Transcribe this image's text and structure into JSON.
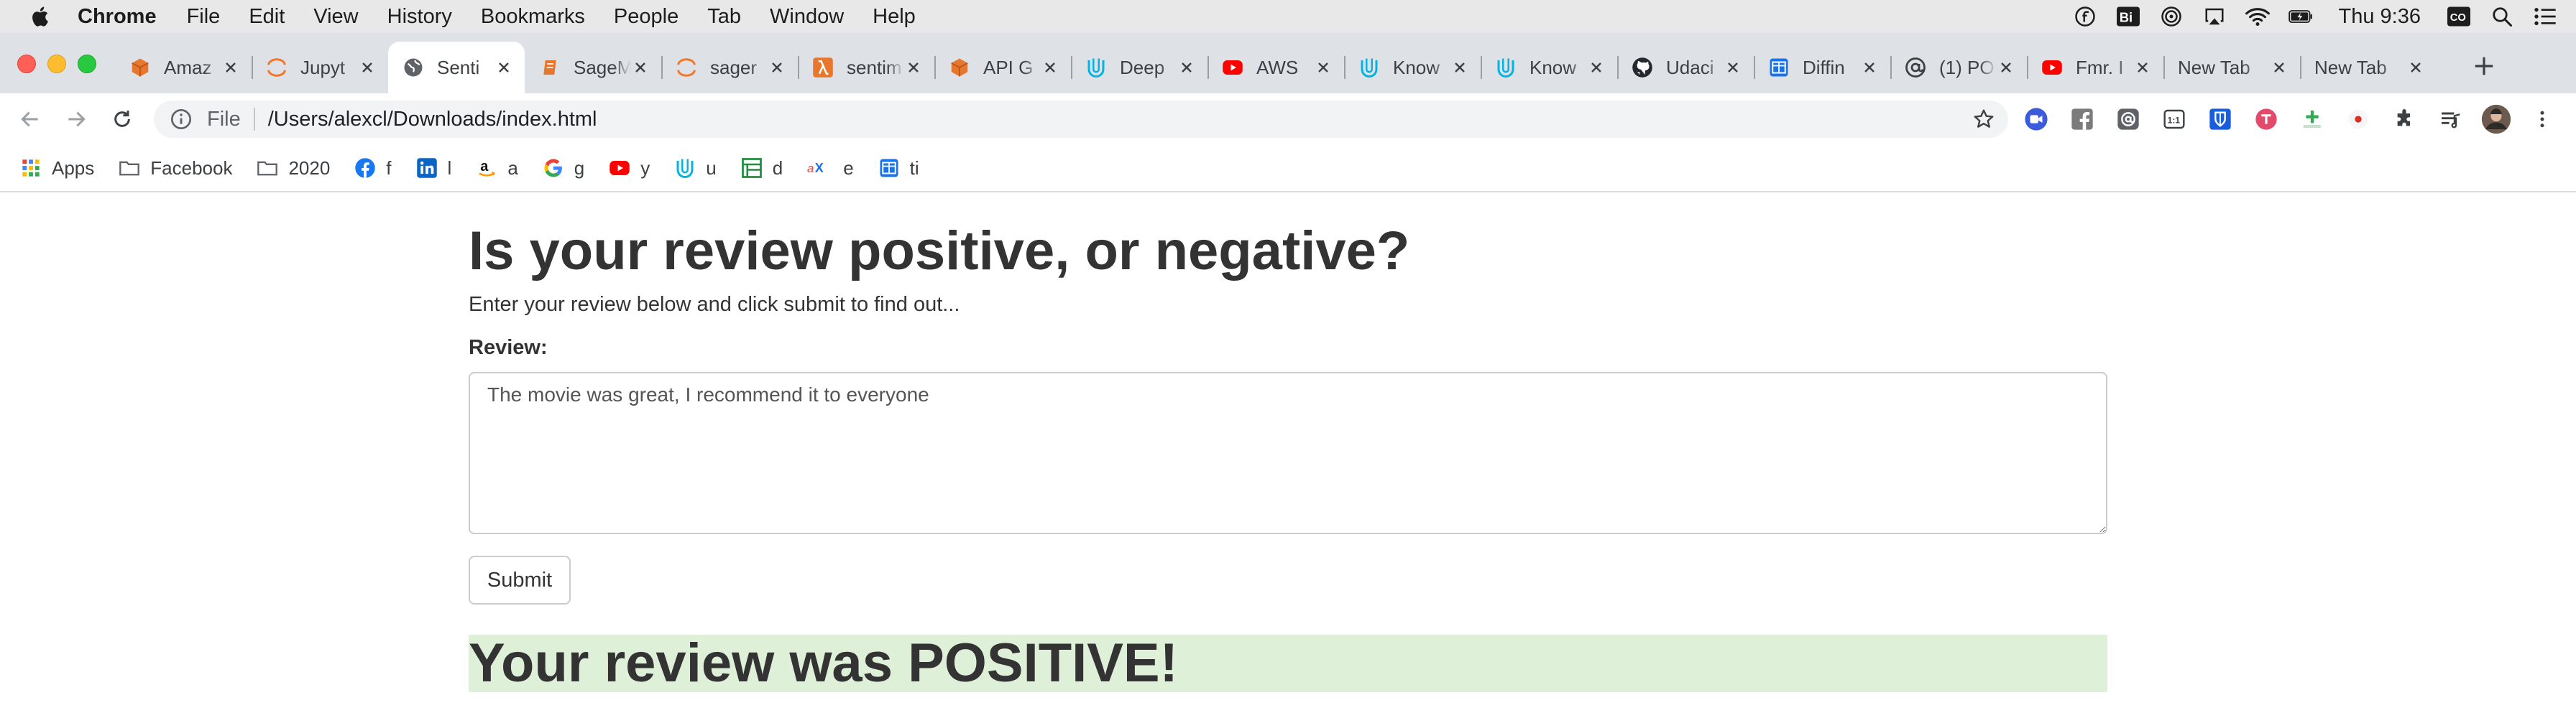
{
  "menubar": {
    "app": "Chrome",
    "items": [
      "File",
      "Edit",
      "View",
      "History",
      "Bookmarks",
      "People",
      "Tab",
      "Window",
      "Help"
    ],
    "clock": "Thu 9:36",
    "status_icons": [
      "circle-f-icon",
      "bi-icon",
      "record-icon",
      "airplay-icon",
      "wifi-icon",
      "battery-icon",
      "co-icon",
      "spotlight-search-icon",
      "control-center-icon"
    ]
  },
  "tabs": [
    {
      "title": "Amaz",
      "icon": "aws-box-icon",
      "color": "#e8772e"
    },
    {
      "title": "Jupyt",
      "icon": "jupyter-icon",
      "color": "#f37726"
    },
    {
      "title": "Senti",
      "icon": "globe-icon",
      "color": "#5f6368",
      "active": true
    },
    {
      "title": "SageM",
      "icon": "sagemaker-icon",
      "color": "#e8772e"
    },
    {
      "title": "sager",
      "icon": "jupyter-icon",
      "color": "#f37726"
    },
    {
      "title": "sentim",
      "icon": "lambda-icon",
      "color": "#e8772e"
    },
    {
      "title": "API G",
      "icon": "aws-box-icon",
      "color": "#e8772e"
    },
    {
      "title": "Deep",
      "icon": "udacity-icon",
      "color": "#02b3e4"
    },
    {
      "title": "AWS",
      "icon": "youtube-icon",
      "color": "#ff0000"
    },
    {
      "title": "Know",
      "icon": "udacity-icon",
      "color": "#02b3e4"
    },
    {
      "title": "Know",
      "icon": "udacity-icon",
      "color": "#02b3e4"
    },
    {
      "title": "Udaci",
      "icon": "github-icon",
      "color": "#24292e"
    },
    {
      "title": "Diffin",
      "icon": "table-icon",
      "color": "#1a73e8"
    },
    {
      "title": "(1) PO",
      "icon": "at-icon",
      "color": "#3c4043"
    },
    {
      "title": "Fmr. I",
      "icon": "youtube-icon",
      "color": "#ff0000"
    },
    {
      "title": "New Tab",
      "icon": "",
      "color": ""
    },
    {
      "title": "New Tab",
      "icon": "",
      "color": ""
    }
  ],
  "toolbar": {
    "scheme": "File",
    "url": "/Users/alexcl/Downloads/index.html",
    "extensions": [
      "meet-icon",
      "facebook-square-icon",
      "at-icon",
      "ratio-icon",
      "bitwarden-icon",
      "todoist-icon",
      "plus-green-icon",
      "record-dot-icon",
      "puzzle-icon",
      "media-queue-icon",
      "profile-avatar-icon",
      "menu-kebab-icon"
    ]
  },
  "bookmarks": [
    {
      "label": "Apps",
      "icon": "apps-grid-icon"
    },
    {
      "label": "Facebook",
      "icon": "folder-icon"
    },
    {
      "label": "2020",
      "icon": "folder-icon"
    },
    {
      "label": "f",
      "icon": "facebook-icon"
    },
    {
      "label": "l",
      "icon": "linkedin-icon"
    },
    {
      "label": "a",
      "icon": "amazon-icon"
    },
    {
      "label": "g",
      "icon": "google-icon"
    },
    {
      "label": "y",
      "icon": "youtube-icon"
    },
    {
      "label": "u",
      "icon": "udacity-icon"
    },
    {
      "label": "d",
      "icon": "store-icon"
    },
    {
      "label": "e",
      "icon": "ax-icon"
    },
    {
      "label": "ti",
      "icon": "table-icon"
    }
  ],
  "page": {
    "heading": "Is your review positive, or negative?",
    "lead": "Enter your review below and click submit to find out...",
    "review_label": "Review:",
    "review_text": "The movie was great, I recommend it to everyone",
    "submit_label": "Submit",
    "result": "Your review was POSITIVE!",
    "result_bg": "#dff0d8"
  }
}
